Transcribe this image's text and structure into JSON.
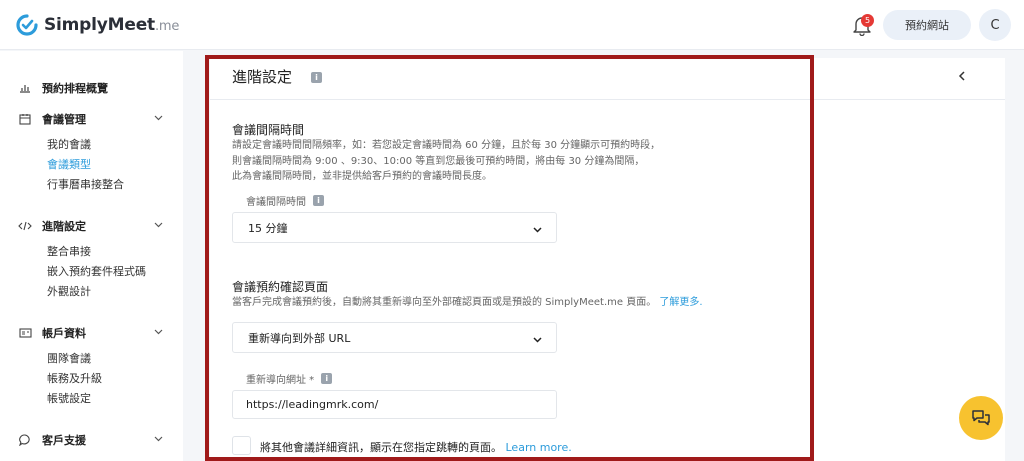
{
  "header": {
    "logo_name": "SimplyMeet",
    "logo_suffix": ".me",
    "notification_count": "5",
    "booking_site_label": "預約網站",
    "avatar_initial": "C"
  },
  "sidebar": {
    "overview": "預約排程概覽",
    "meetings": {
      "label": "會議管理",
      "items": [
        "我的會議",
        "會議類型",
        "行事曆串接整合"
      ]
    },
    "advanced": {
      "label": "進階設定",
      "items": [
        "整合串接",
        "嵌入預約套件程式碼",
        "外觀設計"
      ]
    },
    "account": {
      "label": "帳戶資料",
      "items": [
        "團隊會議",
        "帳務及升級",
        "帳號設定"
      ]
    },
    "support": {
      "label": "客戶支援"
    },
    "active_item": "會議類型"
  },
  "card": {
    "title": "進階設定",
    "interval": {
      "title": "會議間隔時間",
      "desc_lines": [
        "請設定會議時間間隔頻率，如：若您設定會議時間為 60 分鐘，且於每 30 分鐘顯示可預約時段，",
        "則會議間隔時間為 9:00 、9:30、10:00 等直到您最後可預約時間，將由每 30 分鐘為間隔，",
        "此為會議間隔時間，並非提供給客戶預約的會議時間長度。"
      ],
      "field_label": "會議間隔時間",
      "selected": "15 分鐘"
    },
    "confirmation": {
      "title": "會議預約確認頁面",
      "desc": "當客戶完成會議預約後，自動將其重新導向至外部確認頁面或是預設的 SimplyMeet.me 頁面。",
      "learn_more": "了解更多.",
      "selected": "重新導向到外部 URL",
      "url_label": "重新導向網址 *",
      "url_value": "https://leadingmrk.com/",
      "checkbox_label": "將其他會議詳細資訊，顯示在您指定跳轉的頁面。",
      "checkbox_link": "Learn more."
    }
  },
  "colors": {
    "accent": "#2d9cdb",
    "highlight": "#a01a1a",
    "chat": "#f7c22f"
  }
}
